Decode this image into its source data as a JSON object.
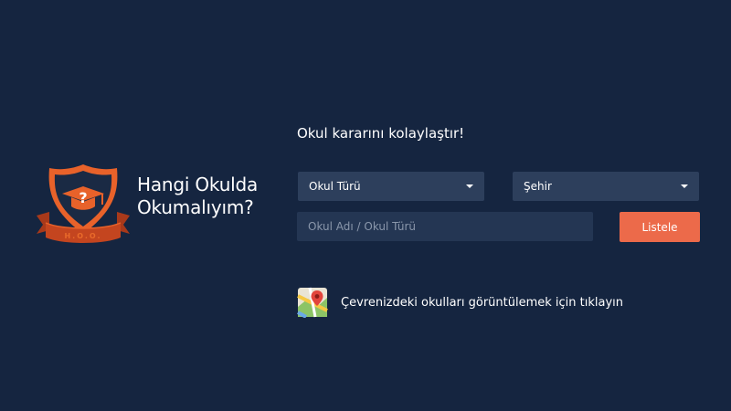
{
  "brand": {
    "title_line1": "Hangi Okulda",
    "title_line2": "Okumalıyım?",
    "emblem_initials": "H.O.O.",
    "emblem_symbol": "?",
    "colors": {
      "shield": "#e8622a",
      "shield_inner": "#1a2a44",
      "ribbon": "#c4451f"
    }
  },
  "search": {
    "tagline": "Okul kararını kolaylaştır!",
    "school_type_select": "Okul Türü",
    "city_select": "Şehir",
    "name_input_placeholder": "Okul Adı / Okul Türü",
    "submit_label": "Listele"
  },
  "nearby": {
    "icon": "map-icon",
    "label": "Çevrenizdeki okulları görüntülemek için tıklayın"
  },
  "colors": {
    "background": "#152540",
    "field": "#2d3f5c",
    "accent": "#ec6a4a"
  }
}
